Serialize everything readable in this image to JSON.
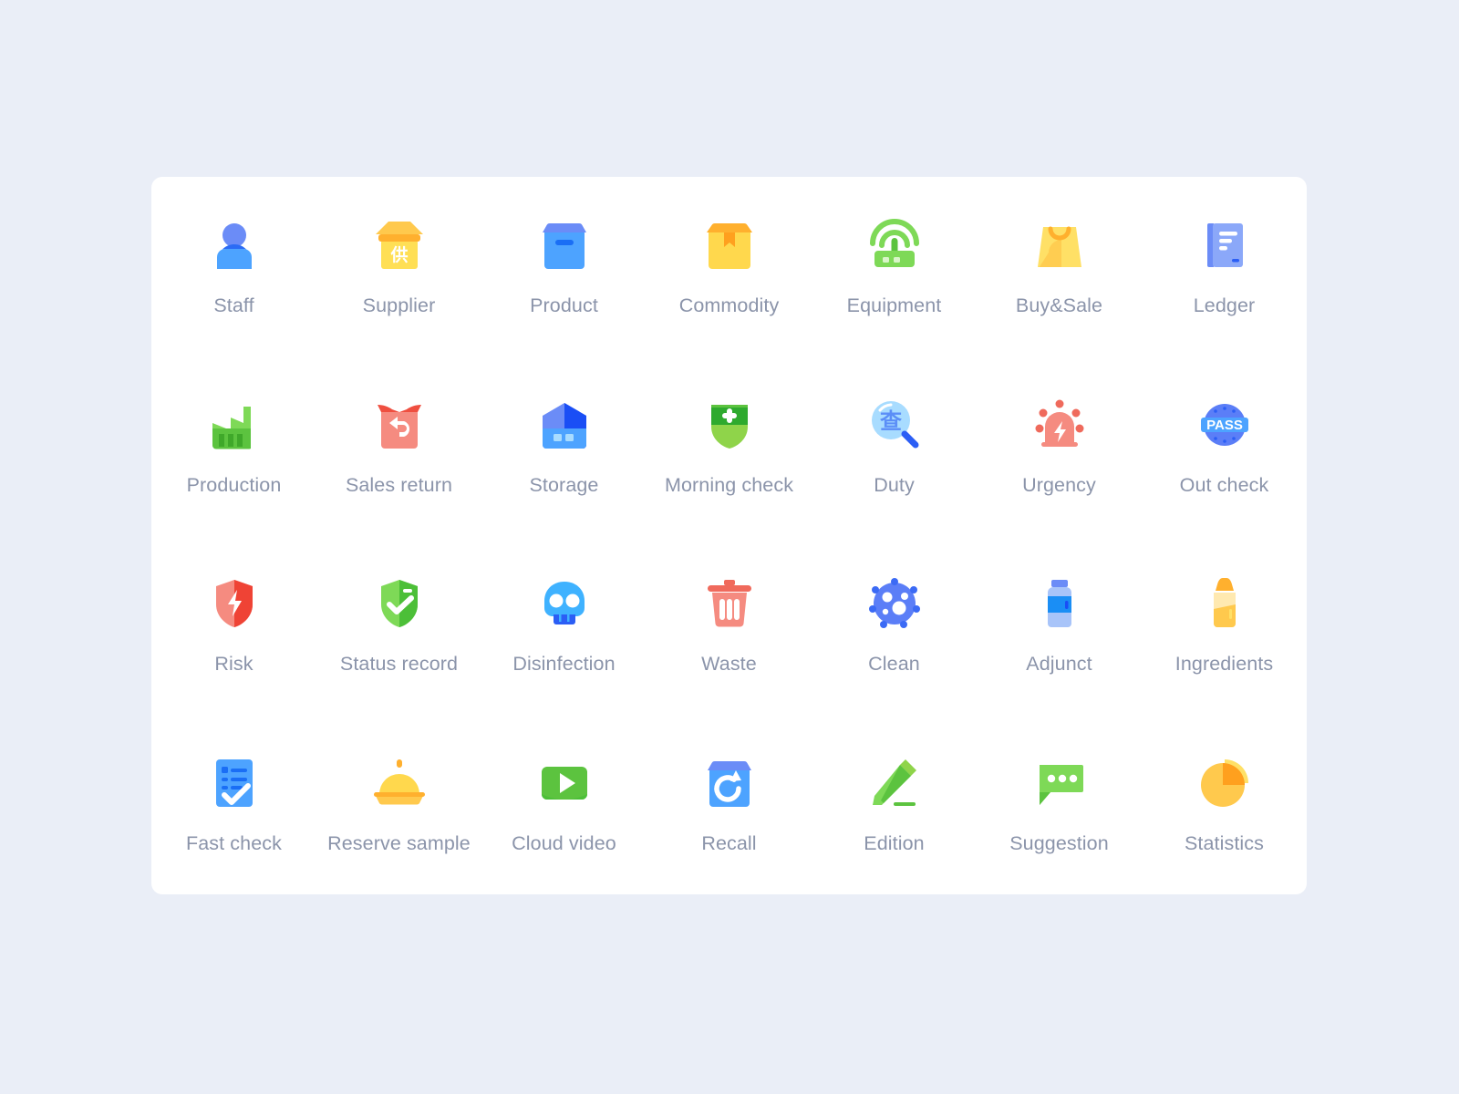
{
  "background_color": "#eaeef7",
  "card": {
    "background_color": "#ffffff",
    "corner_radius": "12px"
  },
  "label_color": "#8b94aa",
  "grid": {
    "columns": 7,
    "rows": 4,
    "total_items": 28
  },
  "items": [
    {
      "label": "Staff",
      "icon": "user-avatar-icon",
      "colors": [
        "#6b8cf7",
        "#4da3ff",
        "#2b6bf5"
      ]
    },
    {
      "label": "Supplier",
      "icon": "supply-shop-icon",
      "colors": [
        "#ffc94d",
        "#ffb02e",
        "#ffdf6b"
      ],
      "glyph_text": "供"
    },
    {
      "label": "Product",
      "icon": "blue-box-icon",
      "colors": [
        "#4da3ff",
        "#6b8cf7",
        "#1a6ef5"
      ]
    },
    {
      "label": "Commodity",
      "icon": "package-box-icon",
      "colors": [
        "#ffd84d",
        "#ffb02e",
        "#ffa01e"
      ]
    },
    {
      "label": "Equipment",
      "icon": "router-signal-icon",
      "colors": [
        "#7ed957",
        "#5cc33f",
        "#d9f5c8"
      ]
    },
    {
      "label": "Buy&Sale",
      "icon": "shopping-bag-icon",
      "colors": [
        "#ffe066",
        "#ffb02e",
        "#ffc94d"
      ]
    },
    {
      "label": "Ledger",
      "icon": "ledger-book-icon",
      "colors": [
        "#8ba8f9",
        "#6b8cf7",
        "#2b5ef5"
      ]
    },
    {
      "label": "Production",
      "icon": "factory-icon",
      "colors": [
        "#7ed957",
        "#5cc33f",
        "#3fa82a"
      ]
    },
    {
      "label": "Sales return",
      "icon": "return-box-icon",
      "colors": [
        "#f58b80",
        "#ef4f40",
        "#ffffff"
      ]
    },
    {
      "label": "Storage",
      "icon": "warehouse-icon",
      "colors": [
        "#4da3ff",
        "#1a4ef5",
        "#6b8cf7"
      ]
    },
    {
      "label": "Morning check",
      "icon": "shield-plus-icon",
      "colors": [
        "#2eaa2e",
        "#8fd44a",
        "#5cc33f"
      ]
    },
    {
      "label": "Duty",
      "icon": "magnifier-check-icon",
      "colors": [
        "#a8dcff",
        "#5b8ef7",
        "#2b5ef5"
      ],
      "glyph_text": "查"
    },
    {
      "label": "Urgency",
      "icon": "alarm-siren-icon",
      "colors": [
        "#f58b80",
        "#ef6a5c",
        "#ffffff"
      ]
    },
    {
      "label": "Out check",
      "icon": "pass-seal-icon",
      "colors": [
        "#5b7ef7",
        "#4da3ff",
        "#ffffff"
      ],
      "glyph_text": "PASS"
    },
    {
      "label": "Risk",
      "icon": "shield-lightning-icon",
      "colors": [
        "#f58b80",
        "#ef4335",
        "#ffffff"
      ]
    },
    {
      "label": "Status record",
      "icon": "shield-check-icon",
      "colors": [
        "#7ed957",
        "#4cbf38",
        "#ffffff"
      ]
    },
    {
      "label": "Disinfection",
      "icon": "skull-icon",
      "colors": [
        "#3fb2ff",
        "#2b5ef5",
        "#ffffff"
      ]
    },
    {
      "label": "Waste",
      "icon": "trash-can-icon",
      "colors": [
        "#f58b80",
        "#f06a5c",
        "#ffffff"
      ]
    },
    {
      "label": "Clean",
      "icon": "sponge-bubble-icon",
      "colors": [
        "#5b7ef7",
        "#3b6af5",
        "#ffffff"
      ]
    },
    {
      "label": "Adjunct",
      "icon": "additive-jar-icon",
      "colors": [
        "#a8c4f9",
        "#1a8ef5",
        "#6b8cf7"
      ]
    },
    {
      "label": "Ingredients",
      "icon": "seasoning-bottle-icon",
      "colors": [
        "#ffd97a",
        "#ffb02e",
        "#ffe9b0"
      ]
    },
    {
      "label": "Fast check",
      "icon": "checklist-icon",
      "colors": [
        "#4da3ff",
        "#1a6ef5",
        "#ffffff"
      ]
    },
    {
      "label": "Reserve sample",
      "icon": "food-cloche-icon",
      "colors": [
        "#ffd84d",
        "#ffb02e",
        "#ffc94d"
      ]
    },
    {
      "label": "Cloud video",
      "icon": "play-button-icon",
      "colors": [
        "#5cc33f",
        "#4cbf38",
        "#ffffff"
      ]
    },
    {
      "label": "Recall",
      "icon": "recall-refresh-icon",
      "colors": [
        "#4da3ff",
        "#6b8cf7",
        "#ffffff"
      ]
    },
    {
      "label": "Edition",
      "icon": "pencil-edit-icon",
      "colors": [
        "#8fd44a",
        "#5cc33f",
        "#7ed957"
      ]
    },
    {
      "label": "Suggestion",
      "icon": "chat-bubble-icon",
      "colors": [
        "#7ed957",
        "#5cc33f",
        "#ffffff"
      ]
    },
    {
      "label": "Statistics",
      "icon": "pie-chart-icon",
      "colors": [
        "#ffc94d",
        "#ffa01e",
        "#ffe066"
      ]
    }
  ]
}
